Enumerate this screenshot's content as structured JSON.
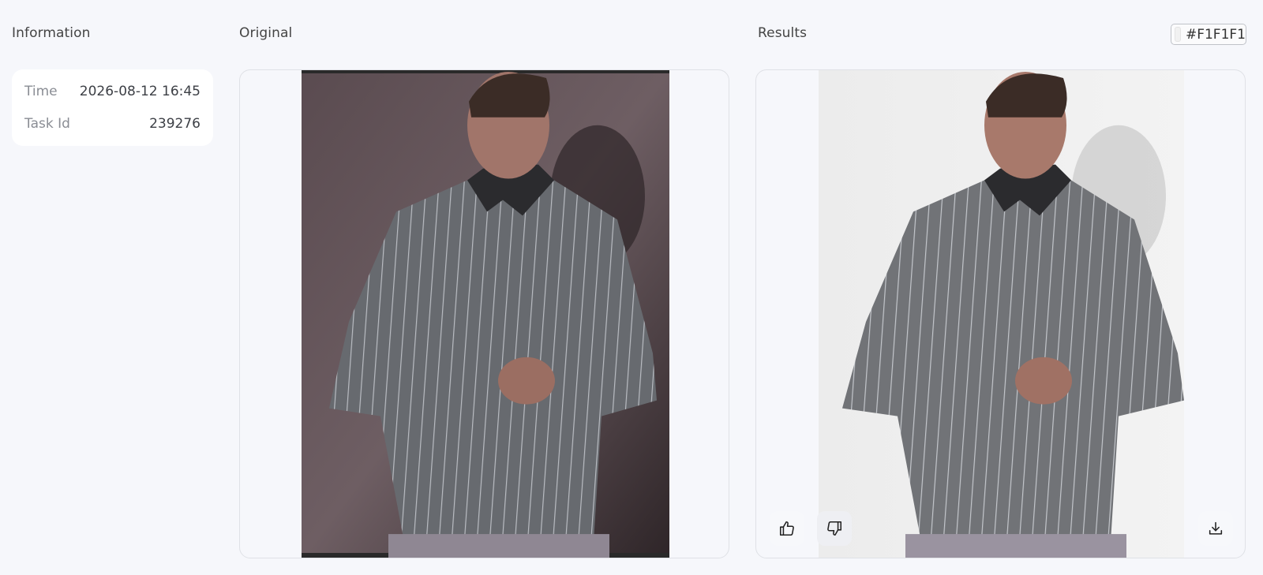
{
  "info": {
    "title": "Information",
    "rows": [
      {
        "label": "Time",
        "value": "2026-08-12 16:45"
      },
      {
        "label": "Task Id",
        "value": "239276"
      }
    ]
  },
  "original": {
    "title": "Original"
  },
  "results": {
    "title": "Results",
    "bg_color_hex": "#F1F1F1"
  },
  "colors": {
    "page_bg": "#f6f7fb",
    "original_bg": "#4a3e42",
    "result_bg": "#f1f1f1",
    "shirt": "#6a6b6e"
  },
  "icons": [
    "thumbs-up-icon",
    "thumbs-down-icon",
    "download-icon"
  ]
}
